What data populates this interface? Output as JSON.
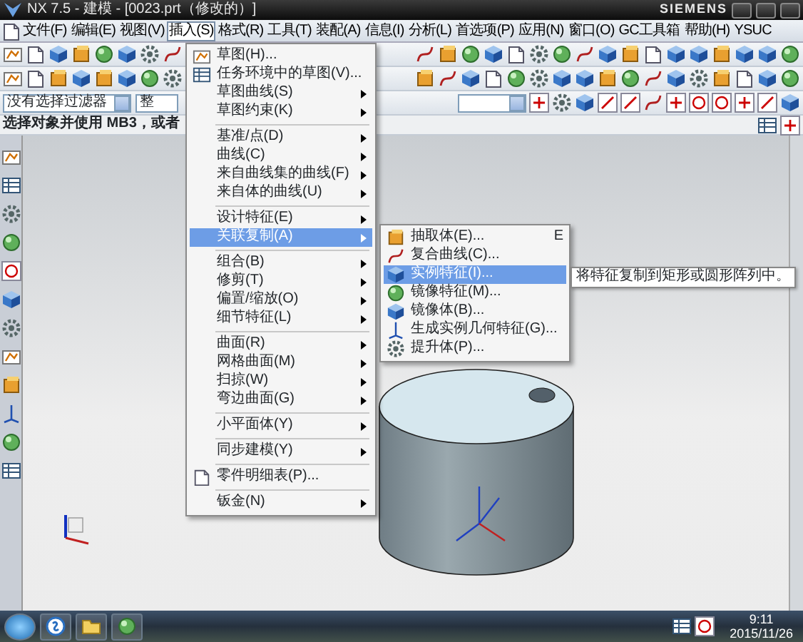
{
  "window": {
    "title": "NX 7.5 - 建模 - [0023.prt（修改的）]",
    "brand": "SIEMENS"
  },
  "menu_bar": [
    {
      "label": "文件(F)",
      "selected": false
    },
    {
      "label": "编辑(E)",
      "selected": false
    },
    {
      "label": "视图(V)",
      "selected": false
    },
    {
      "label": "插入(S)",
      "selected": true
    },
    {
      "label": "格式(R)",
      "selected": false
    },
    {
      "label": "工具(T)",
      "selected": false
    },
    {
      "label": "装配(A)",
      "selected": false
    },
    {
      "label": "信息(I)",
      "selected": false
    },
    {
      "label": "分析(L)",
      "selected": false
    },
    {
      "label": "首选项(P)",
      "selected": false
    },
    {
      "label": "应用(N)",
      "selected": false
    },
    {
      "label": "窗口(O)",
      "selected": false
    },
    {
      "label": "GC工具箱",
      "selected": false
    },
    {
      "label": "帮助(H)",
      "selected": false
    },
    {
      "label": "YSUC",
      "selected": false
    }
  ],
  "selection_bar": {
    "filter": "没有选择过滤器",
    "scope": "整"
  },
  "status_bar": {
    "prompt": "选择对象并使用 MB3，或者"
  },
  "insert_menu": [
    {
      "kind": "command",
      "label": "草图(H)...",
      "selected": false
    },
    {
      "kind": "command",
      "label": "任务环境中的草图(V)...",
      "selected": false
    },
    {
      "kind": "submenu",
      "label": "草图曲线(S)",
      "selected": false
    },
    {
      "kind": "submenu",
      "label": "草图约束(K)",
      "selected": false
    },
    {
      "kind": "separator"
    },
    {
      "kind": "submenu",
      "label": "基准/点(D)",
      "selected": false
    },
    {
      "kind": "submenu",
      "label": "曲线(C)",
      "selected": false
    },
    {
      "kind": "submenu",
      "label": "来自曲线集的曲线(F)",
      "selected": false
    },
    {
      "kind": "submenu",
      "label": "来自体的曲线(U)",
      "selected": false
    },
    {
      "kind": "separator"
    },
    {
      "kind": "submenu",
      "label": "设计特征(E)",
      "selected": false
    },
    {
      "kind": "submenu",
      "label": "关联复制(A)",
      "selected": true
    },
    {
      "kind": "separator"
    },
    {
      "kind": "submenu",
      "label": "组合(B)",
      "selected": false
    },
    {
      "kind": "submenu",
      "label": "修剪(T)",
      "selected": false
    },
    {
      "kind": "submenu",
      "label": "偏置/缩放(O)",
      "selected": false
    },
    {
      "kind": "submenu",
      "label": "细节特征(L)",
      "selected": false
    },
    {
      "kind": "separator"
    },
    {
      "kind": "submenu",
      "label": "曲面(R)",
      "selected": false
    },
    {
      "kind": "submenu",
      "label": "网格曲面(M)",
      "selected": false
    },
    {
      "kind": "submenu",
      "label": "扫掠(W)",
      "selected": false
    },
    {
      "kind": "submenu",
      "label": "弯边曲面(G)",
      "selected": false
    },
    {
      "kind": "separator"
    },
    {
      "kind": "submenu",
      "label": "小平面体(Y)",
      "selected": false
    },
    {
      "kind": "separator"
    },
    {
      "kind": "submenu",
      "label": "同步建模(Y)",
      "selected": false
    },
    {
      "kind": "separator"
    },
    {
      "kind": "command",
      "label": "零件明细表(P)...",
      "selected": false
    },
    {
      "kind": "separator"
    },
    {
      "kind": "submenu",
      "label": "钣金(N)",
      "selected": false
    }
  ],
  "copy_submenu": [
    {
      "label": "抽取体(E)...",
      "shortcut": "E",
      "selected": false
    },
    {
      "label": "复合曲线(C)...",
      "selected": false
    },
    {
      "label": "实例特征(I)...",
      "selected": true
    },
    {
      "label": "镜像特征(M)...",
      "selected": false
    },
    {
      "label": "镜像体(B)...",
      "selected": false
    },
    {
      "label": "生成实例几何特征(G)...",
      "selected": false
    },
    {
      "label": "提升体(P)...",
      "selected": false
    }
  ],
  "tooltip": "将特征复制到矩形或圆形阵列中。",
  "taskbar": {
    "time": "9:11",
    "date": "2015/11/26"
  }
}
